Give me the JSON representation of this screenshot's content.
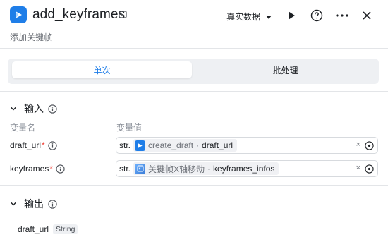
{
  "header": {
    "title": "add_keyframes",
    "subtitle": "添加关键帧",
    "data_mode": "真实数据",
    "brand_color": "#1f7ee8"
  },
  "tabs": [
    {
      "label": "单次",
      "active": true
    },
    {
      "label": "批处理",
      "active": false
    }
  ],
  "input_section": {
    "title": "输入",
    "col_name": "变量名",
    "col_value": "变量值",
    "rows": [
      {
        "name": "draft_url",
        "required": "*",
        "type": "str.",
        "node": "create_draft",
        "sep": "·",
        "var": "draft_url",
        "clear": "×",
        "node_icon": "play-icon"
      },
      {
        "name": "keyframes",
        "required": "*",
        "type": "str.",
        "node": "关键帧X轴移动",
        "sep": "·",
        "var": "keyframes_infos",
        "clear": "×",
        "node_icon": "code-node-icon"
      }
    ]
  },
  "output_section": {
    "title": "输出",
    "var": "draft_url",
    "type": "String"
  }
}
